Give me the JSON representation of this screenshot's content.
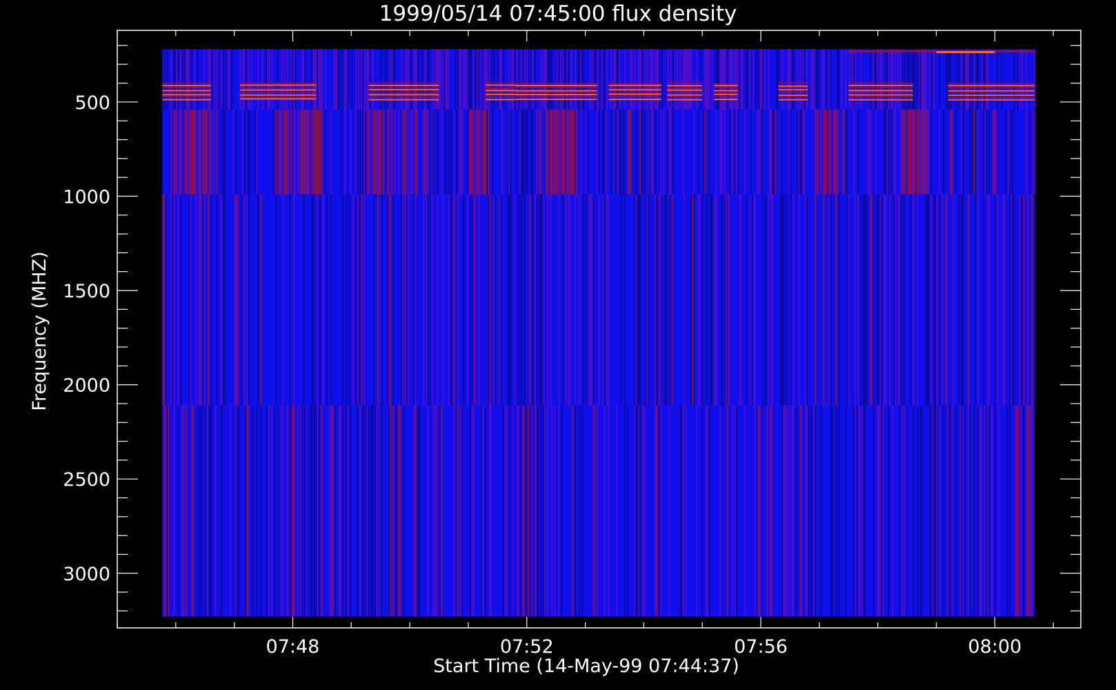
{
  "chart_data": {
    "type": "heatmap",
    "title": "1999/05/14 07:45:00 flux density",
    "xlabel": "Start Time (14-May-99 07:44:37)",
    "ylabel": "Frequency (MHZ)",
    "x_range_minutes": [
      7.0,
      23.47
    ],
    "y_range_mhz": [
      3290,
      120
    ],
    "y_reversed": true,
    "data_extent": {
      "x_minutes": [
        7.77,
        22.68
      ],
      "y_mhz": [
        220,
        3230
      ]
    },
    "x_ticks": [
      {
        "value": 10.0,
        "label": "07:48"
      },
      {
        "value": 14.0,
        "label": "07:52"
      },
      {
        "value": 18.0,
        "label": "07:56"
      },
      {
        "value": 22.0,
        "label": "08:00"
      }
    ],
    "x_minor_step_minutes": 1,
    "y_ticks": [
      {
        "value": 500,
        "label": "500"
      },
      {
        "value": 1000,
        "label": "1000"
      },
      {
        "value": 1500,
        "label": "1500"
      },
      {
        "value": 2000,
        "label": "2000"
      },
      {
        "value": 2500,
        "label": "2500"
      },
      {
        "value": 3000,
        "label": "3000"
      }
    ],
    "y_minor_step_mhz": 100,
    "bands_mhz": [
      {
        "from": 220,
        "to": 540,
        "kind": "noisy-bursts"
      },
      {
        "from": 540,
        "to": 990,
        "kind": "striated-warm"
      },
      {
        "from": 990,
        "to": 2110,
        "kind": "striated"
      },
      {
        "from": 2110,
        "to": 3230,
        "kind": "striated"
      }
    ],
    "burst_intervals_minutes": [
      [
        7.77,
        8.6
      ],
      [
        9.1,
        10.4
      ],
      [
        11.3,
        12.5
      ],
      [
        13.3,
        13.8
      ],
      [
        13.8,
        15.2
      ],
      [
        15.4,
        16.3
      ],
      [
        16.4,
        17.0
      ],
      [
        17.2,
        17.6
      ],
      [
        18.3,
        18.8
      ],
      [
        19.5,
        20.6
      ],
      [
        21.2,
        22.68
      ]
    ],
    "warm_column_intervals_minutes": [
      [
        7.9,
        8.6
      ],
      [
        9.7,
        10.5
      ],
      [
        11.4,
        12.1
      ],
      [
        13.0,
        13.3
      ],
      [
        14.3,
        14.9
      ],
      [
        18.9,
        19.3
      ],
      [
        20.4,
        20.9
      ]
    ],
    "colors": {
      "background": "#000000",
      "base": "#1010ee",
      "dark": "#0a0a90",
      "purple": "#5a10c0",
      "warm": "#a01030",
      "hot": "#ff6a3a",
      "axis": "#ffffff"
    }
  }
}
